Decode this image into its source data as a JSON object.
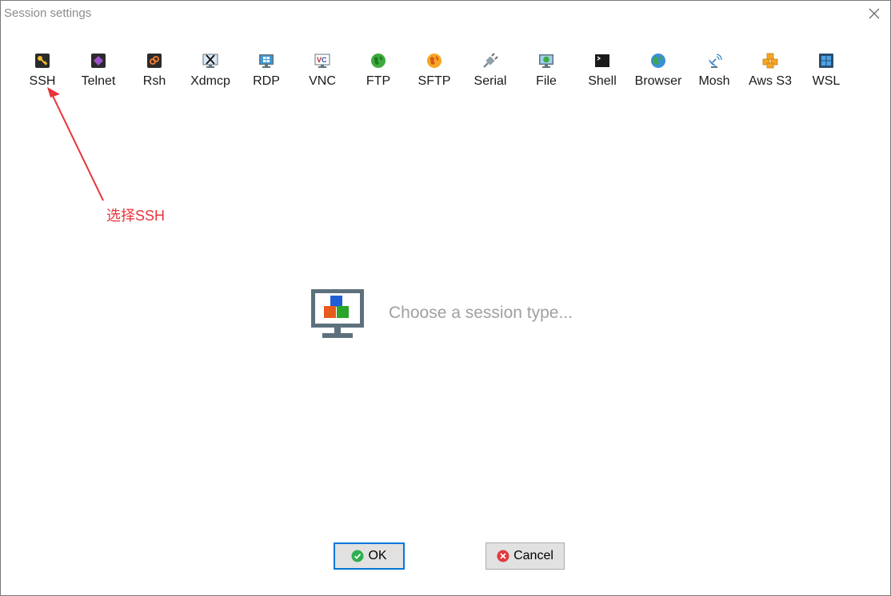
{
  "window": {
    "title": "Session settings"
  },
  "toolbar": {
    "items": [
      {
        "label": "SSH",
        "icon": "ssh-key-icon"
      },
      {
        "label": "Telnet",
        "icon": "telnet-icon"
      },
      {
        "label": "Rsh",
        "icon": "rsh-icon"
      },
      {
        "label": "Xdmcp",
        "icon": "xdmcp-icon"
      },
      {
        "label": "RDP",
        "icon": "rdp-monitor-icon"
      },
      {
        "label": "VNC",
        "icon": "vnc-icon"
      },
      {
        "label": "FTP",
        "icon": "ftp-globe-icon"
      },
      {
        "label": "SFTP",
        "icon": "sftp-globe-icon"
      },
      {
        "label": "Serial",
        "icon": "serial-plug-icon"
      },
      {
        "label": "File",
        "icon": "file-monitor-icon"
      },
      {
        "label": "Shell",
        "icon": "shell-terminal-icon"
      },
      {
        "label": "Browser",
        "icon": "browser-globe-icon"
      },
      {
        "label": "Mosh",
        "icon": "mosh-satellite-icon"
      },
      {
        "label": "Aws S3",
        "icon": "aws-s3-cubes-icon"
      },
      {
        "label": "WSL",
        "icon": "wsl-windows-icon"
      }
    ]
  },
  "annotation": {
    "text": "选择SSH",
    "color": "#e8343a"
  },
  "main": {
    "prompt": "Choose a session type..."
  },
  "buttons": {
    "ok_label": "OK",
    "cancel_label": "Cancel"
  },
  "colors": {
    "ok_border": "#0078d7",
    "ok_icon": "#2eaf4f",
    "cancel_icon": "#e0393e"
  }
}
